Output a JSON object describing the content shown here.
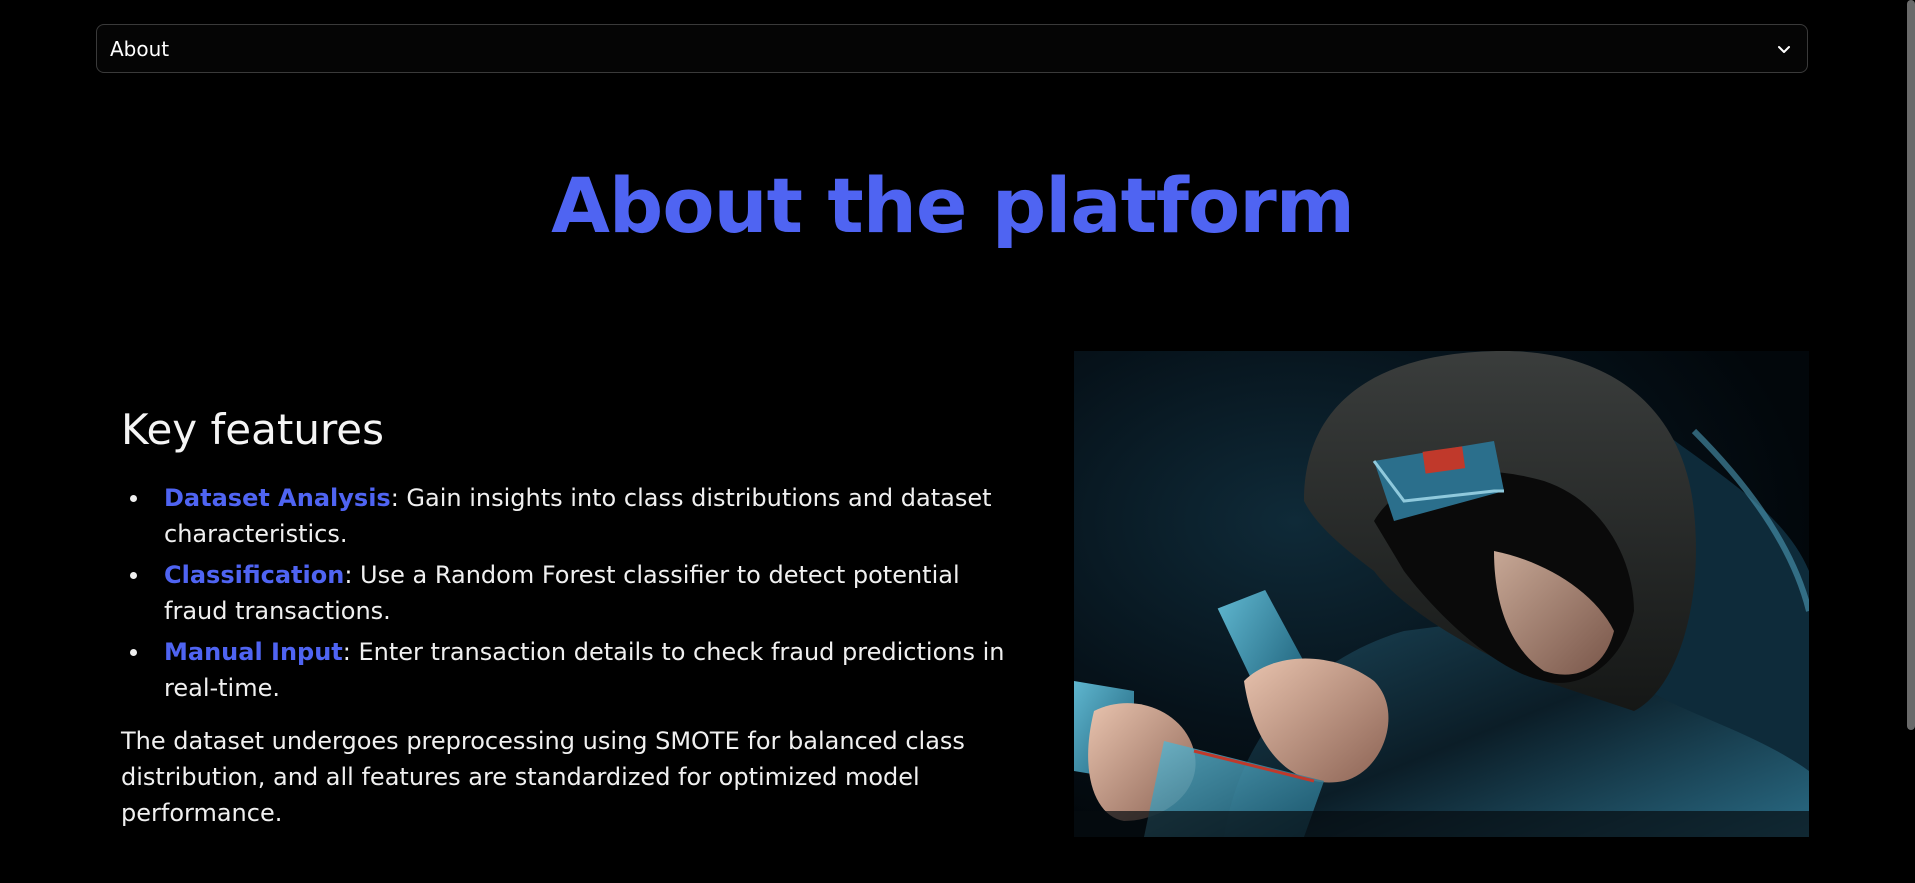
{
  "nav": {
    "selected": "About"
  },
  "title": "About the platform",
  "features": {
    "heading": "Key features",
    "items": [
      {
        "name": "Dataset Analysis",
        "text": ": Gain insights into class distributions and dataset characteristics."
      },
      {
        "name": "Classification",
        "text": ": Use a Random Forest classifier to detect potential fraud transactions."
      },
      {
        "name": "Manual Input",
        "text": ": Enter transaction details to check fraud predictions in real-time."
      }
    ]
  },
  "summary": "The dataset undergoes preprocessing using SMOTE for balanced class distribution, and all features are standardized for optimized model performance.",
  "image": {
    "subject": "hooded-person-with-credit-cards"
  },
  "colors": {
    "accent": "#4f64f2",
    "background": "#000000",
    "text": "#f0f0f0"
  }
}
